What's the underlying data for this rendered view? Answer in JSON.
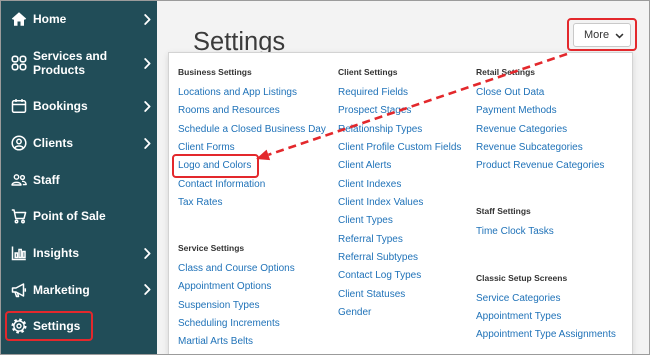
{
  "sidebar": {
    "items": [
      {
        "label": "Home",
        "icon": "home-icon",
        "expandable": true
      },
      {
        "label": "Services and Products",
        "icon": "services-grid-icon",
        "expandable": true
      },
      {
        "label": "Bookings",
        "icon": "calendar-icon",
        "expandable": true
      },
      {
        "label": "Clients",
        "icon": "client-icon",
        "expandable": true
      },
      {
        "label": "Staff",
        "icon": "staff-icon",
        "expandable": false
      },
      {
        "label": "Point of Sale",
        "icon": "cart-icon",
        "expandable": false
      },
      {
        "label": "Insights",
        "icon": "insights-chart-icon",
        "expandable": true
      },
      {
        "label": "Marketing",
        "icon": "megaphone-icon",
        "expandable": true
      },
      {
        "label": "Settings",
        "icon": "gear-icon",
        "expandable": false,
        "active": true
      }
    ]
  },
  "page": {
    "title": "Settings"
  },
  "more_button": {
    "label": "More",
    "icon": "chevron-down-icon"
  },
  "menu": {
    "columns": [
      {
        "sections": [
          {
            "heading": "Business Settings",
            "links": [
              "Locations and App Listings",
              "Rooms and Resources",
              "Schedule a Closed Business Day",
              "Client Forms",
              "Logo and Colors",
              "Contact Information",
              "Tax Rates"
            ]
          },
          {
            "heading": "Service Settings",
            "links": [
              "Class and Course Options",
              "Appointment Options",
              "Suspension Types",
              "Scheduling Increments",
              "Martial Arts Belts"
            ]
          }
        ]
      },
      {
        "sections": [
          {
            "heading": "Client Settings",
            "links": [
              "Required Fields",
              "Prospect Stages",
              "Relationship Types",
              "Client Profile Custom Fields",
              "Client Alerts",
              "Client Indexes",
              "Client Index Values",
              "Client Types",
              "Referral Types",
              "Referral Subtypes",
              "Contact Log Types",
              "Client Statuses",
              "Gender"
            ]
          }
        ]
      },
      {
        "sections": [
          {
            "heading": "Retail Settings",
            "links": [
              "Close Out Data",
              "Payment Methods",
              "Revenue Categories",
              "Revenue Subcategories",
              "Product Revenue Categories"
            ]
          },
          {
            "heading": "Staff Settings",
            "links": [
              "Time Clock Tasks"
            ]
          },
          {
            "heading": "Classic Setup Screens",
            "links": [
              "Service Categories",
              "Appointment Types",
              "Appointment Type Assignments"
            ]
          }
        ]
      }
    ]
  },
  "colors": {
    "sidebar_background": "#214d58",
    "sidebar_text": "#ffffff",
    "page_background": "#f3f3f3",
    "panel_background": "#ffffff",
    "link": "#1f72b8",
    "heading": "#333333",
    "annotation": "#e3282c"
  }
}
